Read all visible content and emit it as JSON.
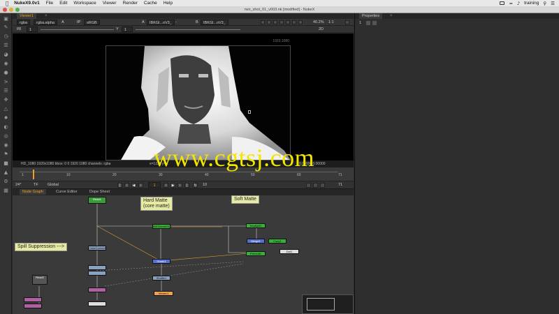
{
  "menubar": {
    "app": "NukeX9.0v1",
    "menus": [
      "File",
      "Edit",
      "Workspace",
      "Viewer",
      "Render",
      "Cache",
      "Help"
    ],
    "user": "training"
  },
  "window": {
    "title": "rwn_shot_01_v003.nk [modified] - NukeX"
  },
  "viewer": {
    "tab": "Viewer1",
    "channels": "rgba",
    "channel_alpha": "rgba.alpha",
    "channel_a": "A",
    "ip": "IP",
    "colorspace": "sRGB",
    "input_a": "A",
    "input_a_node": "IBKGl...oV3_",
    "input_sep": "-",
    "input_b": "B",
    "input_b_node": "IBKGl...oV3_",
    "zoom": "40.2%",
    "ratio": "1:1",
    "frame_ctrl": "f/8",
    "frame_val": "1",
    "y_label": "Y",
    "y_val": "1",
    "mode": "2D",
    "format": "1920,1080",
    "info": "HD_1080 1920x1080  bbox: 0 0 1920 1080 channels: rgba",
    "coords": "x=1224 y=...",
    "pixel_vals": "0.00000  0.00000"
  },
  "timeline": {
    "ticks": [
      "1",
      "10",
      "20",
      "30",
      "40",
      "50",
      "60",
      "71"
    ],
    "start": "1",
    "end": "71",
    "fps": "24*",
    "tf": "TF",
    "scope": "Global",
    "current": "1",
    "step": "10"
  },
  "nodegraph": {
    "tabs": [
      "Node Graph",
      "Curve Editor",
      "Dope Sheet"
    ],
    "stickies": {
      "hard_matte": "Hard Matte\n(core matte)",
      "soft_matte": "Soft Matte",
      "spill": "Spill Suppression --->"
    },
    "nodes": {
      "read_top": "Read1",
      "read_left": "Read2",
      "ibk_gizmo": "IBKGizmoV3_1",
      "keylight": "Keylight1",
      "merge": "Merge1",
      "copy": "Copy1",
      "premult": "Premult1",
      "dot": "Dot1",
      "viewer": "Viewer1",
      "grade": "Grade1",
      "shuffle": "Shuffle1",
      "colorcorrect": "ColorCorrect1"
    }
  },
  "properties": {
    "tab": "Properties",
    "count": "1"
  },
  "watermark": "www.cgtsj.com"
}
